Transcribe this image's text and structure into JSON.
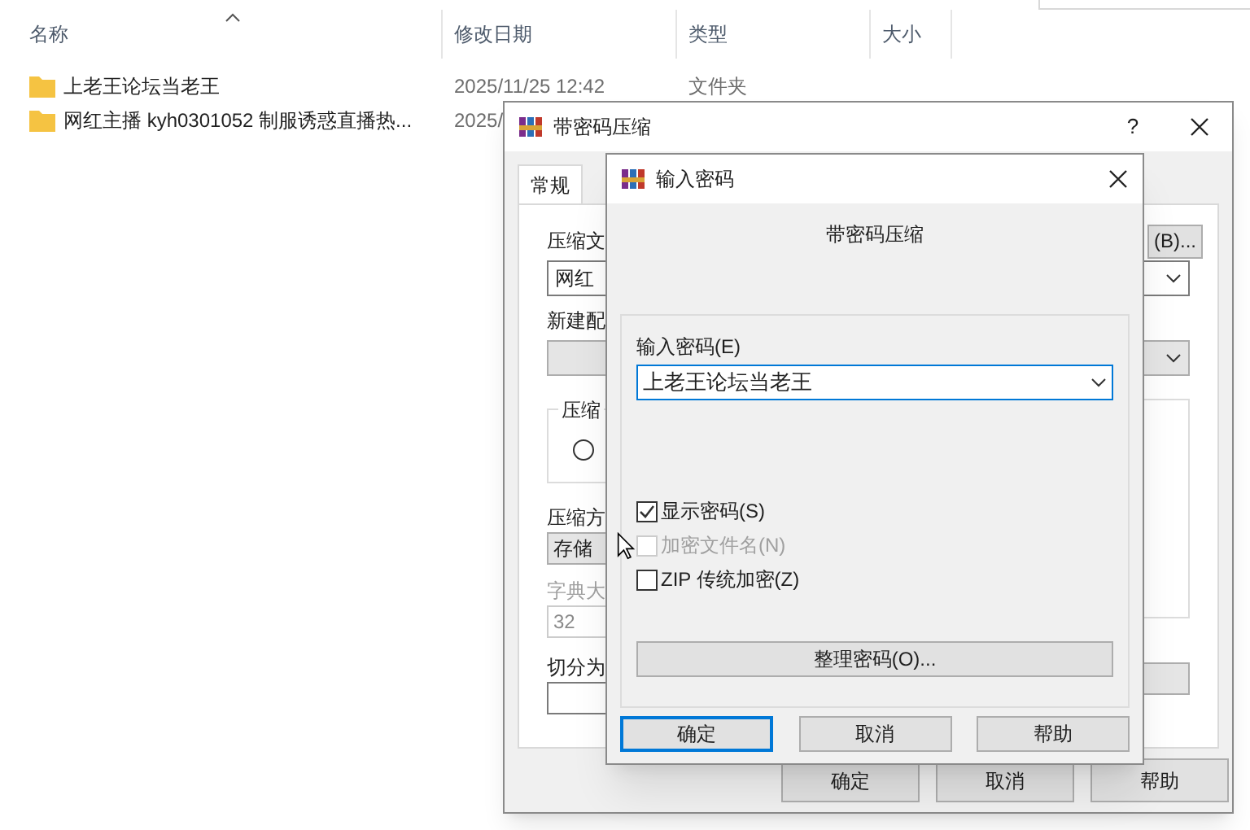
{
  "explorer": {
    "columns": [
      {
        "label": "名称"
      },
      {
        "label": "修改日期"
      },
      {
        "label": "类型"
      },
      {
        "label": "大小"
      }
    ],
    "rows": [
      {
        "name": "上老王论坛当老王",
        "date": "2025/11/25 12:42",
        "type": "文件夹"
      },
      {
        "name": "网红主播 kyh0301052 制服诱惑直播热...",
        "date": "2025/"
      }
    ]
  },
  "archive_dialog": {
    "title": "带密码压缩",
    "help": "?",
    "tabs": [
      {
        "label": "常规",
        "selected": true
      }
    ],
    "archive_name_label": "压缩文",
    "browse_button": "(B)...",
    "archive_name": "网红",
    "profile_label": "新建配",
    "format_group": "压缩",
    "format_radio": {
      "selected": false
    },
    "method_label": "压缩方",
    "method": "存储",
    "dictionary_label": "字典大",
    "dictionary": "32",
    "dictionary_disabled": true,
    "split_label": "切分为",
    "buttons": [
      "确定",
      "取消",
      "帮助"
    ]
  },
  "password_dialog": {
    "title": "输入密码",
    "heading": "带密码压缩",
    "password_label": "输入密码(E)",
    "password": "上老王论坛当老王",
    "options": [
      {
        "label": "显示密码(S)",
        "checked": true,
        "disabled": false
      },
      {
        "label": "加密文件名(N)",
        "checked": false,
        "disabled": true
      },
      {
        "label": "ZIP 传统加密(Z)",
        "checked": false,
        "disabled": false
      }
    ],
    "organize_button": "整理密码(O)...",
    "buttons": [
      {
        "label": "确定",
        "default": true
      },
      {
        "label": "取消",
        "default": false
      },
      {
        "label": "帮助",
        "default": false
      }
    ]
  }
}
